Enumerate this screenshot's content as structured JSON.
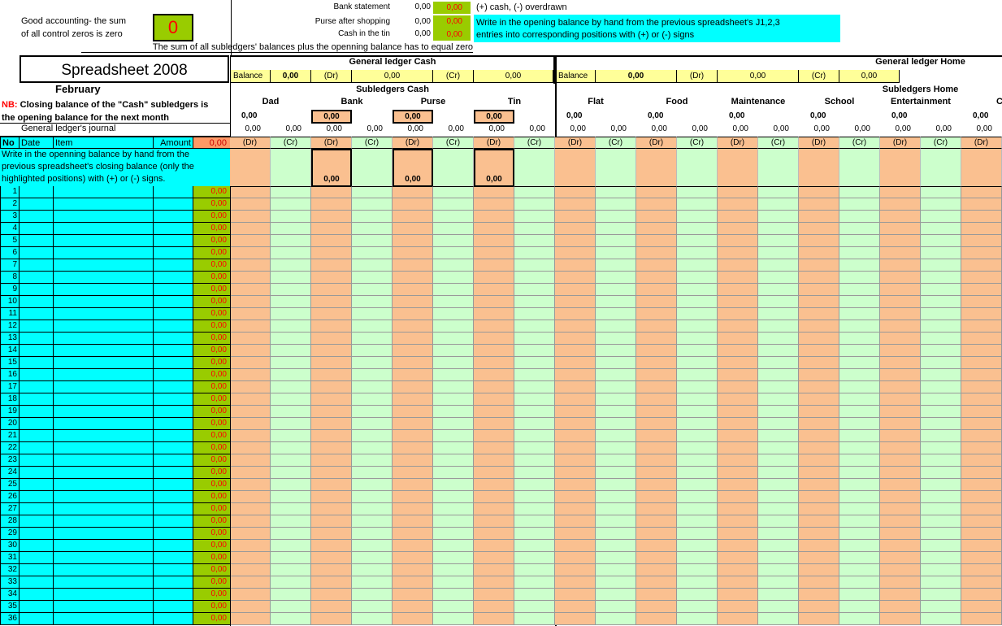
{
  "control": {
    "good_line1": "Good accounting- the sum",
    "good_line2": "of all control zeros is zero",
    "zero_value": "0",
    "bank_label": "Bank statement",
    "bank_value": "0,00",
    "bank_ctrl": "0,00",
    "purse_label": "Purse after shopping",
    "purse_value": "0,00",
    "purse_ctrl": "0,00",
    "tin_label": "Cash in the tin",
    "tin_value": "0,00",
    "tin_ctrl": "0,00",
    "sign_note": "(+) cash, (-) overdrawn",
    "instruction_line1": "Write in the opening balance by hand from the previous spreadsheet's J1,2,3",
    "instruction_line2": "entries into corresponding positions with (+) or (-) signs",
    "sum_note": "The sum of all subledgers' balances plus the openning balance has to equal zero"
  },
  "title": "Spreadsheet 2008",
  "month": "February",
  "nb": {
    "prefix": "NB:",
    "line1": "Closing balance of the \"Cash\" subledgers is",
    "line2": "the opening balance for the next month"
  },
  "journal": {
    "title": "General ledger's journal",
    "headers": {
      "no": "No",
      "date": "Date",
      "item": "Item",
      "amount": "Amount"
    },
    "amount_total": "0,00",
    "open_note_1": "Write in the openning balance by hand from the",
    "open_note_2": "previous spreadsheet's closing balance (only the",
    "open_note_3": "highlighted positions) with (+) or (-) signs.",
    "row_amount": "0,00"
  },
  "gl_cash": {
    "title": "General ledger Cash",
    "balance_label": "Balance",
    "balance_value": "0,00",
    "dr_label": "(Dr)",
    "dr_value": "0,00",
    "cr_label": "(Cr)",
    "cr_value": "0,00",
    "sub_title": "Subledgers Cash",
    "subledgers": [
      "Dad",
      "Bank",
      "Purse",
      "Tin"
    ]
  },
  "gl_home": {
    "title": "General ledger Home",
    "balance_label": "Balance",
    "balance_value": "0,00",
    "dr_label": "(Dr)",
    "dr_value": "0,00",
    "cr_label": "(Cr)",
    "cr_value": "0,00",
    "sub_title": "Subledgers Home",
    "subledgers": [
      "Flat",
      "Food",
      "Maintenance",
      "School",
      "Entertainment",
      "Ca"
    ]
  },
  "cells": {
    "zero": "0,00",
    "dr": "(Dr)",
    "cr": "(Cr)"
  },
  "rows": [
    "1",
    "2",
    "3",
    "4",
    "5",
    "6",
    "7",
    "8",
    "9",
    "10",
    "11",
    "12",
    "13",
    "14",
    "15",
    "16",
    "17",
    "18",
    "19",
    "20",
    "21",
    "22",
    "23",
    "24",
    "25",
    "26",
    "27",
    "28",
    "29",
    "30",
    "31",
    "32",
    "33",
    "34",
    "35",
    "36"
  ],
  "colors": {
    "peach": "#fac090",
    "green": "#ccffcc",
    "cyan": "#00ffff",
    "olive": "#99cc00",
    "yellow": "#ffff99"
  }
}
